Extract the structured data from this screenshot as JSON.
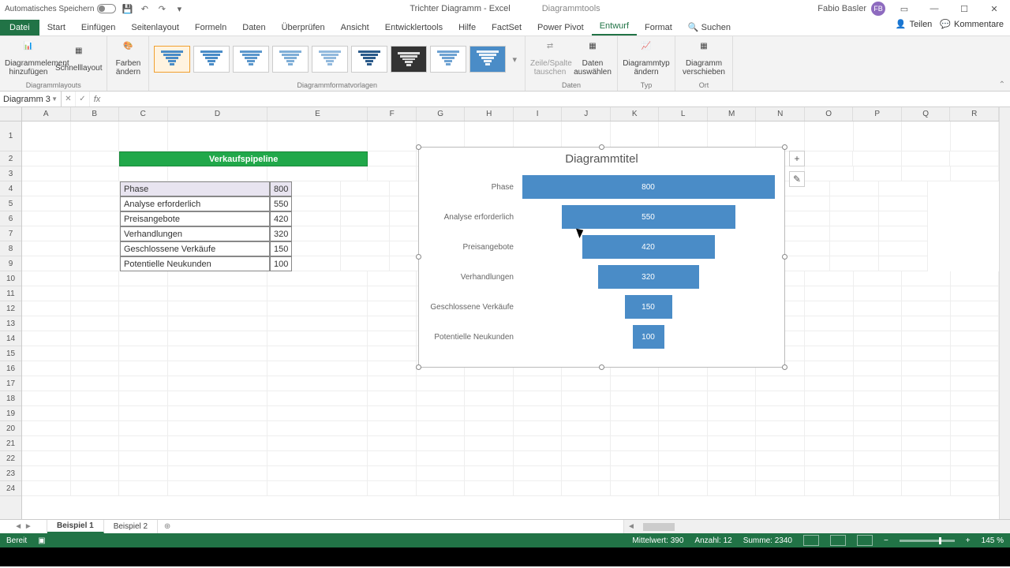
{
  "titlebar": {
    "autosave_label": "Automatisches Speichern",
    "doc_title": "Trichter Diagramm - Excel",
    "tools_title": "Diagrammtools",
    "user_name": "Fabio Basler",
    "user_initials": "FB"
  },
  "tabs": {
    "file": "Datei",
    "items": [
      "Start",
      "Einfügen",
      "Seitenlayout",
      "Formeln",
      "Daten",
      "Überprüfen",
      "Ansicht",
      "Entwicklertools",
      "Hilfe",
      "FactSet",
      "Power Pivot",
      "Entwurf",
      "Format"
    ],
    "active": "Entwurf",
    "search_icon": "Suchen",
    "share": "Teilen",
    "comments": "Kommentare"
  },
  "ribbon": {
    "group_layouts": "Diagrammlayouts",
    "add_element": "Diagrammelement hinzufügen",
    "quick_layout": "Schnelllayout",
    "colors": "Farben ändern",
    "group_styles": "Diagrammformatvorlagen",
    "group_data": "Daten",
    "switch_rowcol": "Zeile/Spalte tauschen",
    "select_data": "Daten auswählen",
    "group_type": "Typ",
    "change_type": "Diagrammtyp ändern",
    "group_loc": "Ort",
    "move_chart": "Diagramm verschieben"
  },
  "namebox": "Diagramm 3",
  "columns": [
    "A",
    "B",
    "C",
    "D",
    "E",
    "F",
    "G",
    "H",
    "I",
    "J",
    "K",
    "L",
    "M",
    "N",
    "O",
    "P",
    "Q",
    "R"
  ],
  "table": {
    "title": "Verkaufspipeline",
    "rows": [
      {
        "label": "Phase",
        "value": "800"
      },
      {
        "label": "Analyse erforderlich",
        "value": "550"
      },
      {
        "label": "Preisangebote",
        "value": "420"
      },
      {
        "label": "Verhandlungen",
        "value": "320"
      },
      {
        "label": "Geschlossene Verkäufe",
        "value": "150"
      },
      {
        "label": "Potentielle Neukunden",
        "value": "100"
      }
    ]
  },
  "chart_data": {
    "type": "bar",
    "title": "Diagrammtitel",
    "categories": [
      "Phase",
      "Analyse erforderlich",
      "Preisangebote",
      "Verhandlungen",
      "Geschlossene Verkäufe",
      "Potentielle Neukunden"
    ],
    "values": [
      800,
      550,
      420,
      320,
      150,
      100
    ],
    "xlabel": "",
    "ylabel": "",
    "ylim": [
      0,
      800
    ]
  },
  "sheets": {
    "active": "Beispiel 1",
    "items": [
      "Beispiel 1",
      "Beispiel 2"
    ]
  },
  "status": {
    "ready": "Bereit",
    "avg_label": "Mittelwert:",
    "avg": "390",
    "count_label": "Anzahl:",
    "count": "12",
    "sum_label": "Summe:",
    "sum": "2340",
    "zoom": "145 %"
  }
}
